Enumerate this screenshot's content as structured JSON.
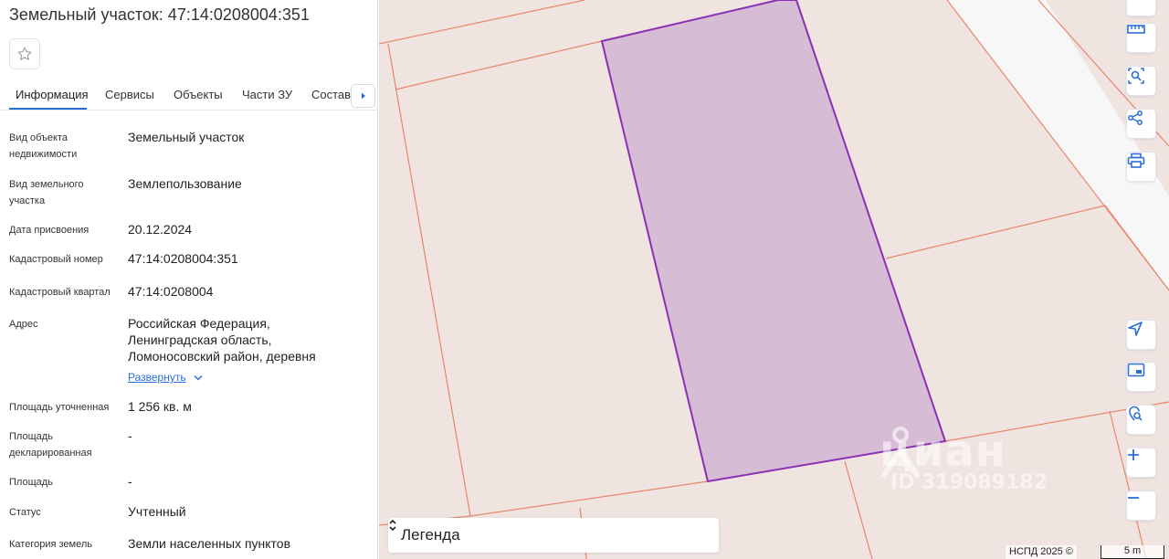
{
  "panel": {
    "title": "Земельный участок: 47:14:0208004:351",
    "favorite_icon": "star-outline-icon",
    "tabs": [
      {
        "label": "Информация",
        "active": true
      },
      {
        "label": "Сервисы",
        "active": false
      },
      {
        "label": "Объекты",
        "active": false
      },
      {
        "label": "Части ЗУ",
        "active": false
      },
      {
        "label": "Состав",
        "active": false
      }
    ],
    "rows": [
      {
        "label": "Вид объекта недвижимости",
        "value": "Земельный участок"
      },
      {
        "label": "Вид земельного участка",
        "value": "Землепользование"
      },
      {
        "label": "Дата присвоения",
        "value": "20.12.2024"
      },
      {
        "label": "Кадастровый номер",
        "value": "47:14:0208004:351"
      },
      {
        "label": "Кадастровый квартал",
        "value": "47:14:0208004"
      },
      {
        "label": "Адрес",
        "value": "Российская Федерация, Ленинградская область, Ломоносовский район, деревня"
      },
      {
        "label": "Площадь уточненная",
        "value": "1 256 кв. м"
      },
      {
        "label": "Площадь декларированная",
        "value": "-"
      },
      {
        "label": "Площадь",
        "value": "-"
      },
      {
        "label": "Статус",
        "value": "Учтенный"
      },
      {
        "label": "Категория земель",
        "value": "Земли населенных пунктов"
      }
    ],
    "expand_label": "Развернуть"
  },
  "map": {
    "tools": [
      "ruler-icon",
      "area-select-icon",
      "share-icon",
      "print-icon"
    ],
    "nav": [
      "locate-icon",
      "minimap-icon",
      "geo-search-icon",
      "zoom-in-icon",
      "zoom-out-icon"
    ],
    "legend_label": "Легенда",
    "watermark_brand": "циан",
    "watermark_id": "ID 319089182",
    "attribution": "НСПД 2025 ©",
    "scale_label": "5 m",
    "colors": {
      "background": "#f0e4e1",
      "parcel_lines": "#e8866b",
      "selected_fill": "#d7bcd6",
      "selected_stroke": "#8b2fb5",
      "accent": "#2b6fd6"
    }
  }
}
